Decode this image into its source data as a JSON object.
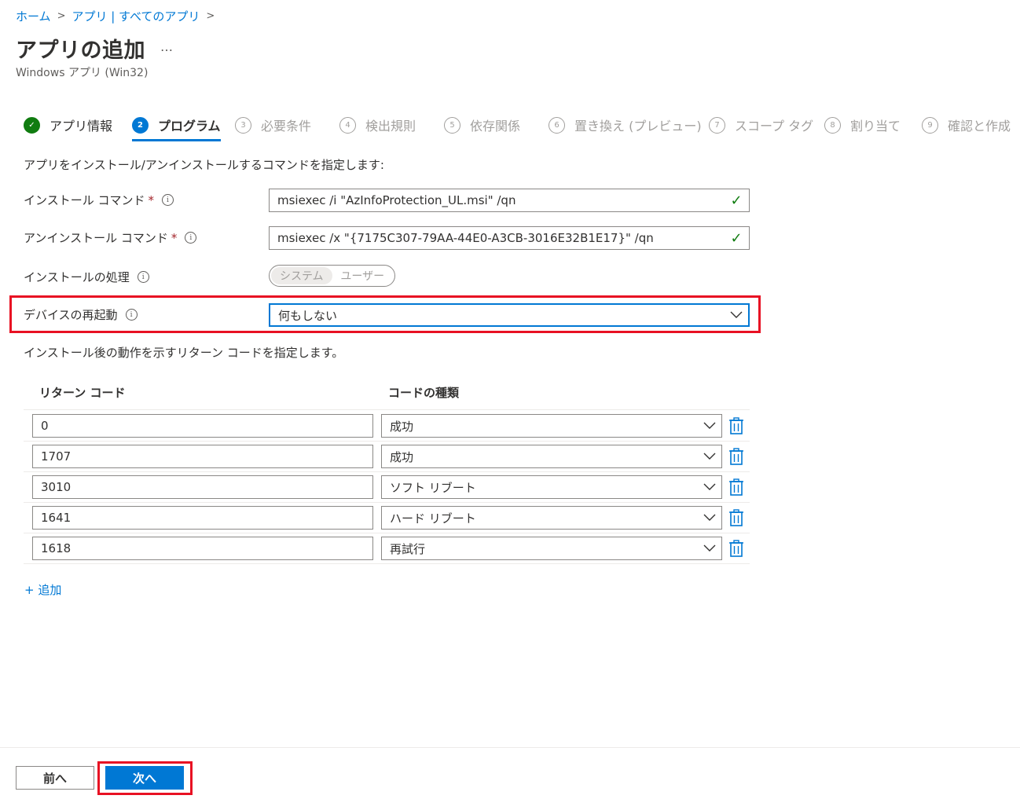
{
  "breadcrumb": {
    "home": "ホーム",
    "apps": "アプリ | すべてのアプリ"
  },
  "header": {
    "title": "アプリの追加",
    "more": "…",
    "subtitle": "Windows アプリ (Win32)"
  },
  "wizard": {
    "steps": [
      {
        "num": "✓",
        "label": "アプリ情報",
        "state": "done"
      },
      {
        "num": "2",
        "label": "プログラム",
        "state": "active"
      },
      {
        "num": "3",
        "label": "必要条件",
        "state": "pending"
      },
      {
        "num": "4",
        "label": "検出規則",
        "state": "pending"
      },
      {
        "num": "5",
        "label": "依存関係",
        "state": "pending"
      },
      {
        "num": "6",
        "label": "置き換え (プレビュー)",
        "state": "pending"
      },
      {
        "num": "7",
        "label": "スコープ タグ",
        "state": "pending"
      },
      {
        "num": "8",
        "label": "割り当て",
        "state": "pending"
      },
      {
        "num": "9",
        "label": "確認と作成",
        "state": "pending"
      }
    ]
  },
  "form": {
    "description": "アプリをインストール/アンインストールするコマンドを指定します:",
    "install_label": "インストール コマンド",
    "install_value": "msiexec /i \"AzInfoProtection_UL.msi\" /qn",
    "uninstall_label": "アンインストール コマンド",
    "uninstall_value": "msiexec /x \"{7175C307-79AA-44E0-A3CB-3016E32B1E17}\" /qn",
    "behavior_label": "インストールの処理",
    "behavior_options": [
      "システム",
      "ユーザー"
    ],
    "behavior_selected": "システム",
    "restart_label": "デバイスの再起動",
    "restart_value": "何もしない",
    "required_mark": "*",
    "info_glyph": "i",
    "check_glyph": "✓"
  },
  "return_codes": {
    "description": "インストール後の動作を示すリターン コードを指定します。",
    "col_code": "リターン コード",
    "col_type": "コードの種類",
    "rows": [
      {
        "code": "0",
        "type": "成功"
      },
      {
        "code": "1707",
        "type": "成功"
      },
      {
        "code": "3010",
        "type": "ソフト リブート"
      },
      {
        "code": "1641",
        "type": "ハード リブート"
      },
      {
        "code": "1618",
        "type": "再試行"
      }
    ],
    "add_label": "+ 追加"
  },
  "footer": {
    "prev_label": "前へ",
    "next_label": "次へ"
  },
  "colors": {
    "accent": "#0078d4",
    "success": "#107c10",
    "highlight": "#e81123",
    "required": "#a4262c"
  }
}
